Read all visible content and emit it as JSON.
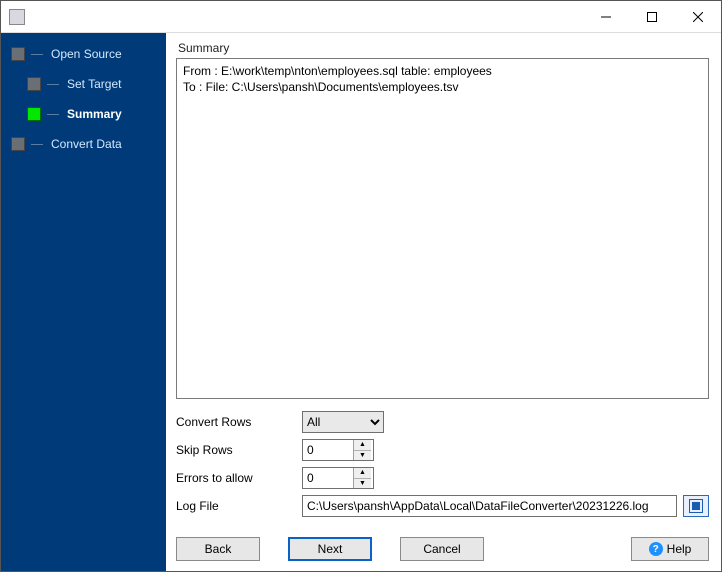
{
  "window": {
    "title": ""
  },
  "sidebar": {
    "items": [
      {
        "label": "Open Source",
        "active": false
      },
      {
        "label": "Set Target",
        "active": false
      },
      {
        "label": "Summary",
        "active": true
      },
      {
        "label": "Convert Data",
        "active": false
      }
    ]
  },
  "page": {
    "title": "Summary",
    "summary_text": "From : E:\\work\\temp\\nton\\employees.sql table: employees\nTo : File: C:\\Users\\pansh\\Documents\\employees.tsv"
  },
  "form": {
    "convert_rows": {
      "label": "Convert Rows",
      "selected": "All",
      "options": [
        "All"
      ]
    },
    "skip_rows": {
      "label": "Skip Rows",
      "value": "0"
    },
    "errors_allow": {
      "label": "Errors to allow",
      "value": "0"
    },
    "log_file": {
      "label": "Log File",
      "value": "C:\\Users\\pansh\\AppData\\Local\\DataFileConverter\\20231226.log"
    }
  },
  "buttons": {
    "back": "Back",
    "next": "Next",
    "cancel": "Cancel",
    "help": "Help"
  }
}
